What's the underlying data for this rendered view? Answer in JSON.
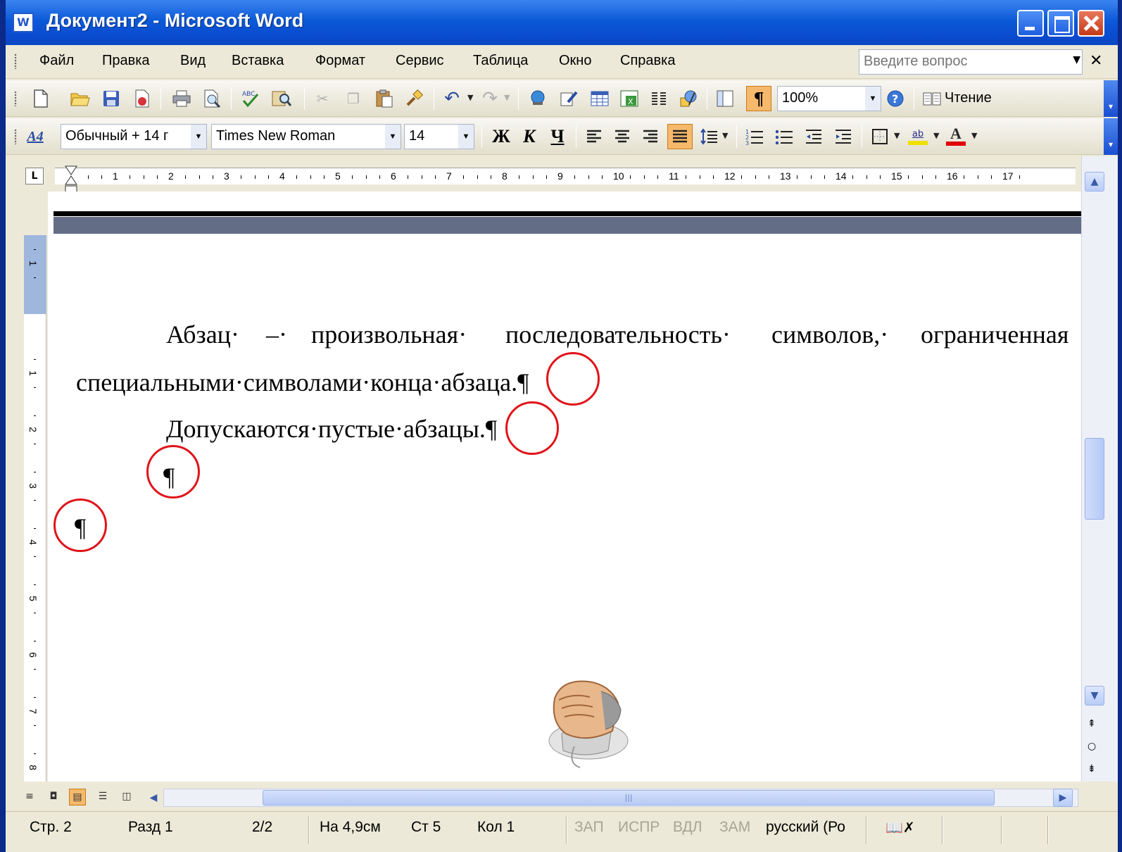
{
  "window": {
    "title": "Документ2 - Microsoft Word"
  },
  "menu": {
    "items": [
      "Файл",
      "Правка",
      "Вид",
      "Вставка",
      "Формат",
      "Сервис",
      "Таблица",
      "Окно",
      "Справка"
    ],
    "help_placeholder": "Введите вопрос"
  },
  "toolbar_standard": {
    "zoom": "100%",
    "read_label": "Чтение",
    "icons": [
      "new-icon",
      "open-icon",
      "save-icon",
      "permission-icon",
      "print-icon",
      "print-preview-icon",
      "spelling-icon",
      "research-icon",
      "cut-icon",
      "copy-icon",
      "paste-icon",
      "format-painter-icon",
      "undo-icon",
      "redo-icon",
      "hyperlink-icon",
      "tables-borders-icon",
      "insert-table-icon",
      "insert-excel-icon",
      "columns-icon",
      "drawing-icon",
      "document-map-icon",
      "show-formatting-icon",
      "help-icon",
      "read-icon"
    ]
  },
  "toolbar_formatting": {
    "style": "Обычный + 14 г",
    "font": "Times New Roman",
    "size": "14",
    "bold": "Ж",
    "italic": "К",
    "underline": "Ч",
    "highlight_label": "ab",
    "font_color_label": "A",
    "accent_colors": {
      "highlight": "#f0e000",
      "font_color": "#e00000",
      "pressed": "#f6b96b"
    }
  },
  "ruler": {
    "numbers": [
      "1",
      "2",
      "3",
      "4",
      "5",
      "6",
      "7",
      "8",
      "9",
      "10",
      "11",
      "12",
      "13",
      "14",
      "15",
      "16",
      "17"
    ],
    "vertical_numbers": [
      "1",
      "1",
      "2",
      "3",
      "4",
      "5",
      "6",
      "7",
      "8"
    ]
  },
  "document": {
    "paragraph1_line1": [
      "Абзац·",
      "–·",
      "произвольная·",
      "последовательность·",
      "символов,·",
      "ограниченная"
    ],
    "paragraph1_line2": "специальными·символами·конца·абзаца.",
    "paragraph2": "Допускаются·пустые·абзацы.",
    "pilcrow": "¶",
    "highlight_color": "#e0141a"
  },
  "status_bar": {
    "page": "Стр. 2",
    "section": "Разд 1",
    "pages": "2/2",
    "at": "На 4,9см",
    "line": "Ст 5",
    "column": "Кол 1",
    "rec": "ЗАП",
    "trk": "ИСПР",
    "ext": "ВДЛ",
    "ovr": "ЗАМ",
    "language": "русский (Ро"
  }
}
